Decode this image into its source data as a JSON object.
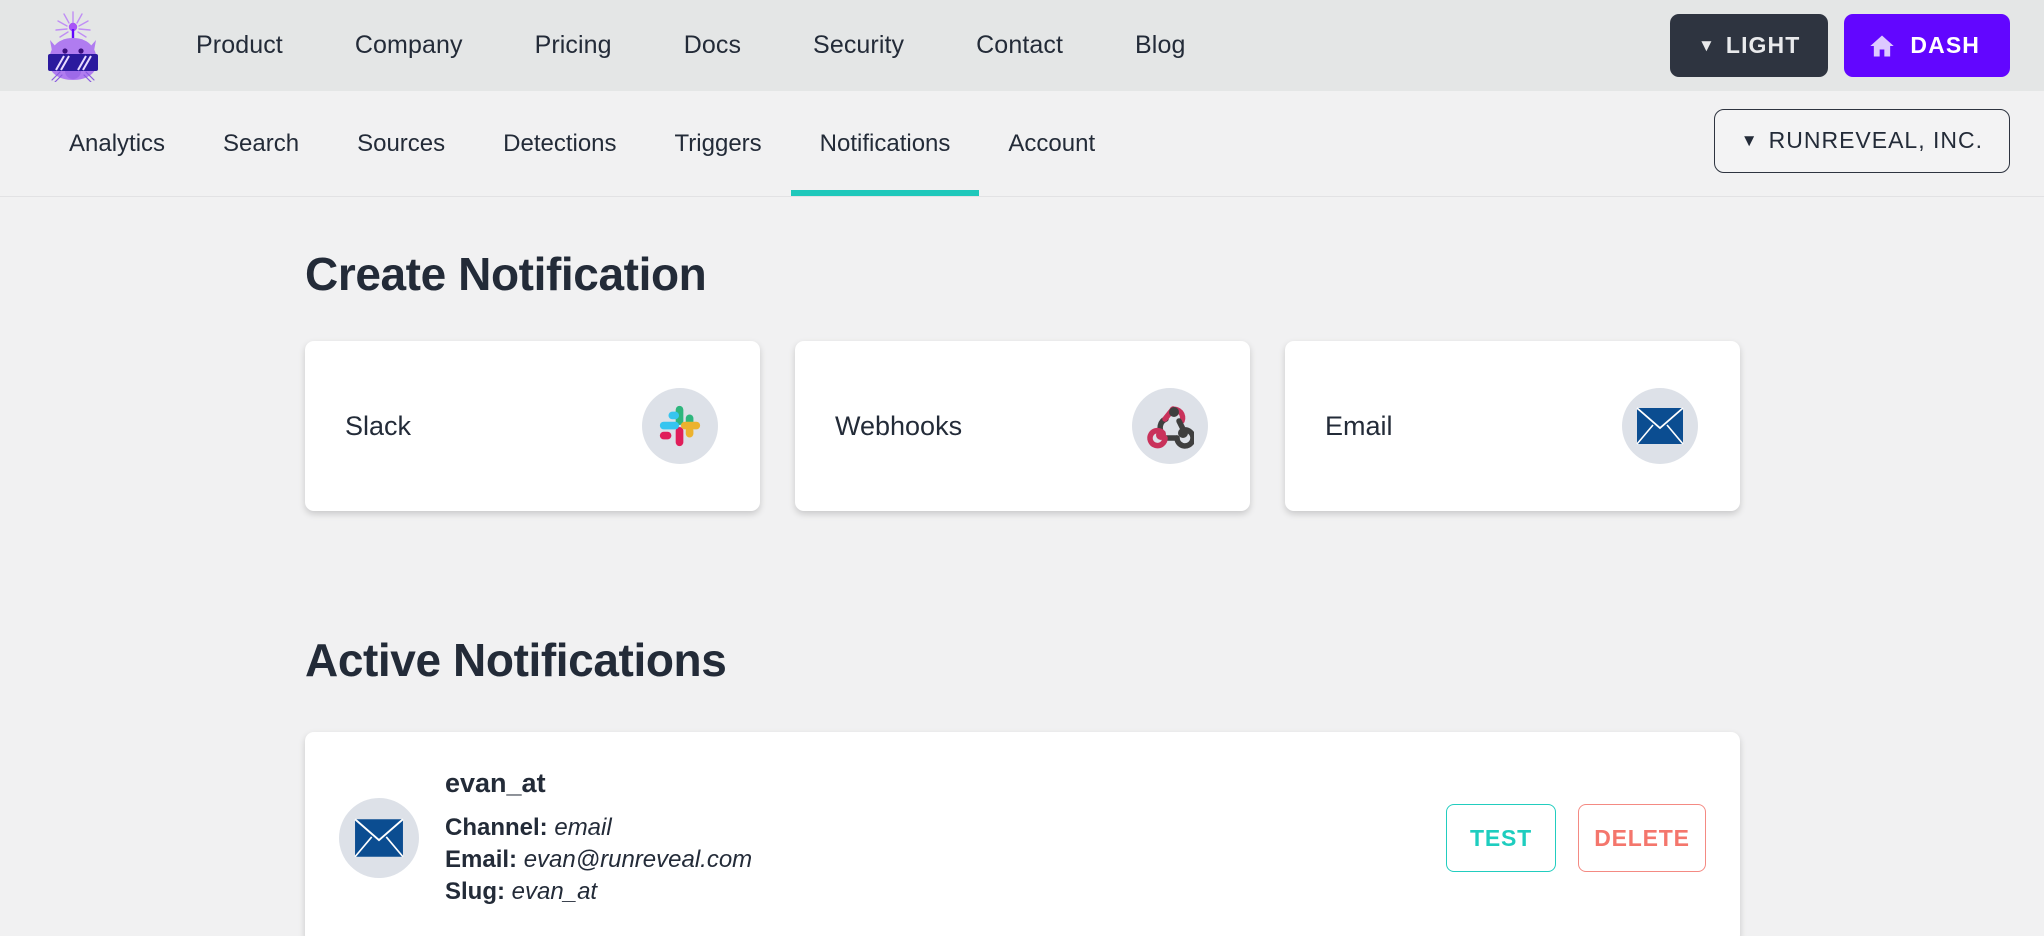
{
  "header": {
    "logo_name": "runreveal-cat-logo",
    "nav": [
      {
        "label": "Product"
      },
      {
        "label": "Company"
      },
      {
        "label": "Pricing"
      },
      {
        "label": "Docs"
      },
      {
        "label": "Security"
      },
      {
        "label": "Contact"
      },
      {
        "label": "Blog"
      }
    ],
    "theme_button": {
      "caret": "▼",
      "label": "LIGHT"
    },
    "dash_button": {
      "icon": "home-icon",
      "label": "DASH"
    },
    "colors": {
      "bar_bg": "#e4e6e6",
      "dash_bg": "#6206ff",
      "theme_bg": "#2e3440"
    }
  },
  "subnav": {
    "items": [
      {
        "label": "Analytics",
        "active": false
      },
      {
        "label": "Search",
        "active": false
      },
      {
        "label": "Sources",
        "active": false
      },
      {
        "label": "Detections",
        "active": false
      },
      {
        "label": "Triggers",
        "active": false
      },
      {
        "label": "Notifications",
        "active": true
      },
      {
        "label": "Account",
        "active": false
      }
    ],
    "org_selector": {
      "caret": "▼",
      "label": "RUNREVEAL, INC."
    },
    "active_color": "#1fc8bb"
  },
  "main": {
    "create_title": "Create Notification",
    "channels": [
      {
        "label": "Slack",
        "icon": "slack-icon"
      },
      {
        "label": "Webhooks",
        "icon": "webhook-icon"
      },
      {
        "label": "Email",
        "icon": "email-envelope-icon"
      }
    ],
    "active_title": "Active Notifications",
    "notifications": [
      {
        "name": "evan_at",
        "avatar_icon": "email-envelope-icon",
        "fields": [
          {
            "label": "Channel:",
            "value": "email"
          },
          {
            "label": "Email:",
            "value": "evan@runreveal.com"
          },
          {
            "label": "Slug:",
            "value": "evan_at"
          }
        ],
        "test_label": "TEST",
        "delete_label": "DELETE"
      }
    ],
    "colors": {
      "test": "#1ecdbf",
      "delete": "#f4766c",
      "card_bg": "#ffffff",
      "page_bg": "#f1f1f2"
    }
  }
}
